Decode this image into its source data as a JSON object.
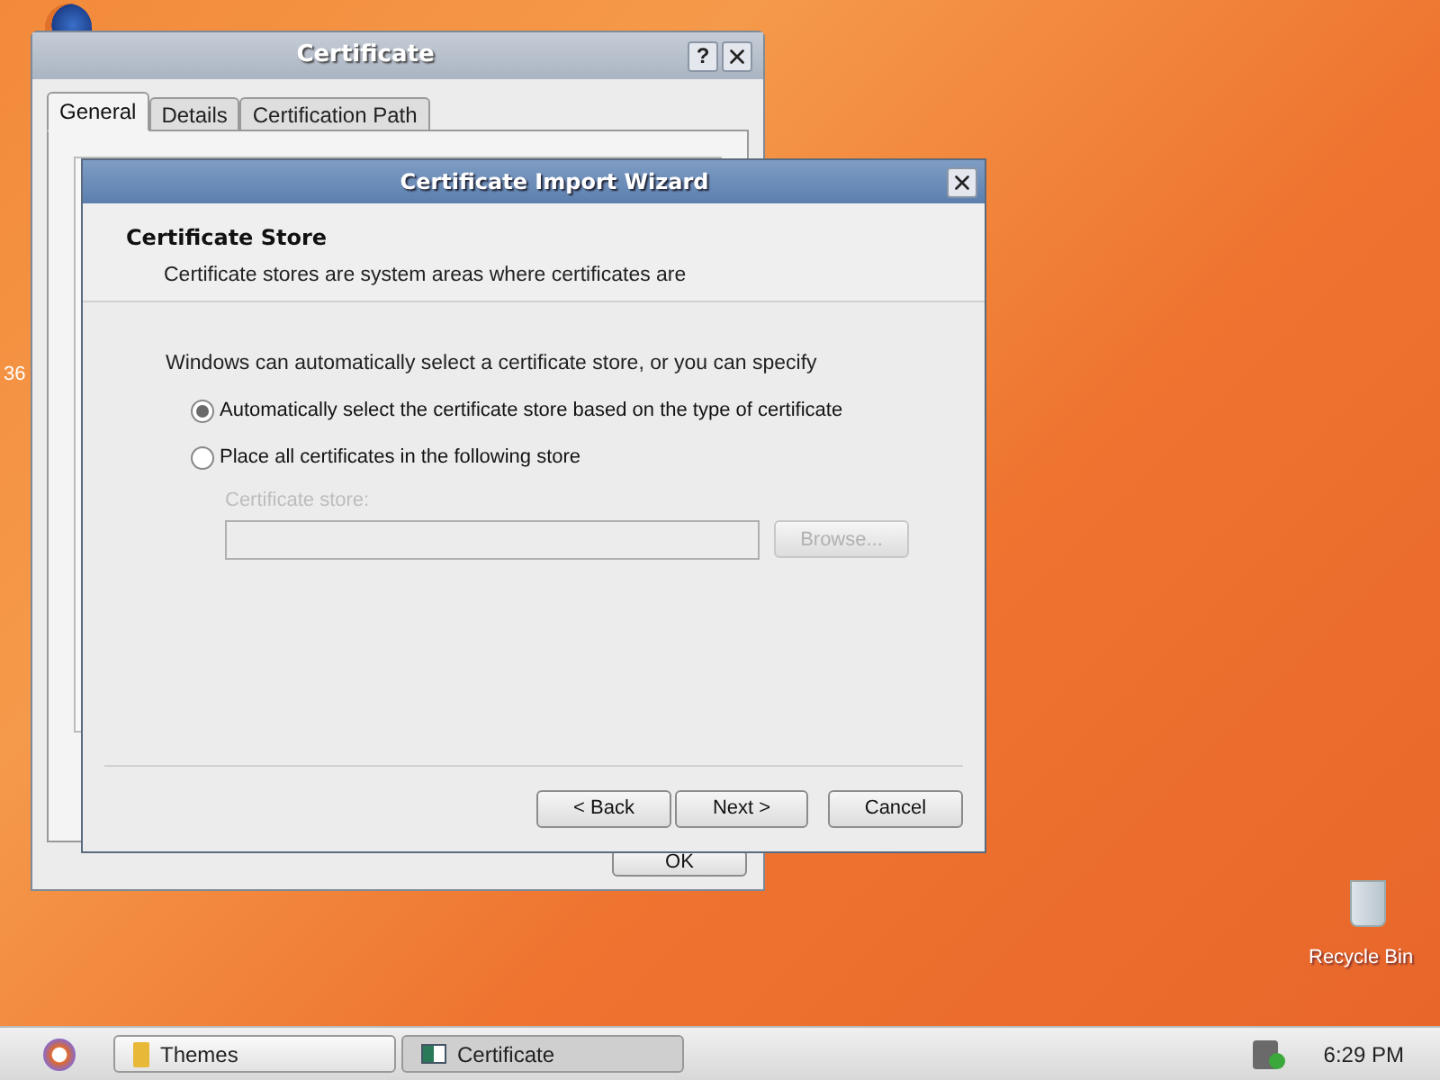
{
  "desktop": {
    "icon_label": "36",
    "recycle_bin": "Recycle Bin"
  },
  "certificate_window": {
    "title": "Certificate",
    "help_button": "?",
    "tabs": [
      {
        "label": "General",
        "selected": true
      },
      {
        "label": "Details",
        "selected": false
      },
      {
        "label": "Certification Path",
        "selected": false
      }
    ],
    "ok_button": "OK"
  },
  "wizard": {
    "title": "Certificate Import Wizard",
    "heading": "Certificate Store",
    "description": "Certificate stores are system areas where certificates are",
    "intro": "Windows can automatically select a certificate store, or you can specify",
    "options": [
      {
        "label": "Automatically select the certificate store based on the type of certificate",
        "selected": true
      },
      {
        "label": "Place all certificates in the following store",
        "selected": false
      }
    ],
    "store_label": "Certificate store:",
    "store_disabled": true,
    "browse_button": "Browse...",
    "buttons": [
      "< Back",
      "Next >",
      "Cancel"
    ]
  },
  "taskbar": {
    "tasks": [
      {
        "label": "Themes",
        "kind": "folder",
        "selected": false
      },
      {
        "label": "Certificate",
        "kind": "window",
        "selected": true
      }
    ],
    "clock": "6:29 PM"
  }
}
